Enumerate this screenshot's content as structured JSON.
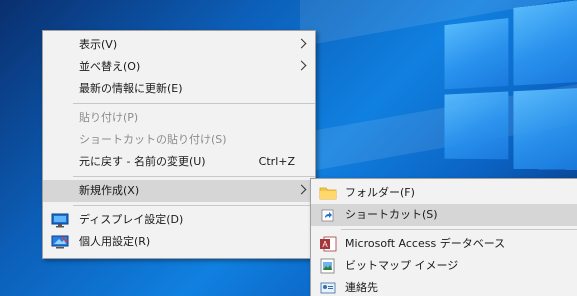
{
  "main_menu": {
    "items": [
      {
        "label": "表示(V)",
        "submenu": true
      },
      {
        "label": "並べ替え(O)",
        "submenu": true
      },
      {
        "label": "最新の情報に更新(E)"
      },
      {
        "label": "貼り付け(P)",
        "disabled": true
      },
      {
        "label": "ショートカットの貼り付け(S)",
        "disabled": true
      },
      {
        "label": "元に戻す - 名前の変更(U)",
        "shortcut": "Ctrl+Z"
      },
      {
        "label": "新規作成(X)",
        "submenu": true,
        "highlighted": true
      },
      {
        "label": "ディスプレイ設定(D)",
        "icon": "display-settings-icon"
      },
      {
        "label": "個人用設定(R)",
        "icon": "personalize-icon"
      }
    ]
  },
  "sub_menu": {
    "items": [
      {
        "label": "フォルダー(F)",
        "icon": "folder-icon"
      },
      {
        "label": "ショートカット(S)",
        "icon": "shortcut-icon",
        "highlighted": true
      },
      {
        "label": "Microsoft Access データベース",
        "icon": "access-icon"
      },
      {
        "label": "ビットマップ イメージ",
        "icon": "bitmap-icon"
      },
      {
        "label": "連絡先",
        "icon": "contact-icon"
      }
    ]
  },
  "colors": {
    "menu_bg": "#f2f2f2",
    "highlight": "#d6d6d6",
    "disabled_text": "#8c8c8c",
    "desktop_blue": "#0c5fb8"
  }
}
